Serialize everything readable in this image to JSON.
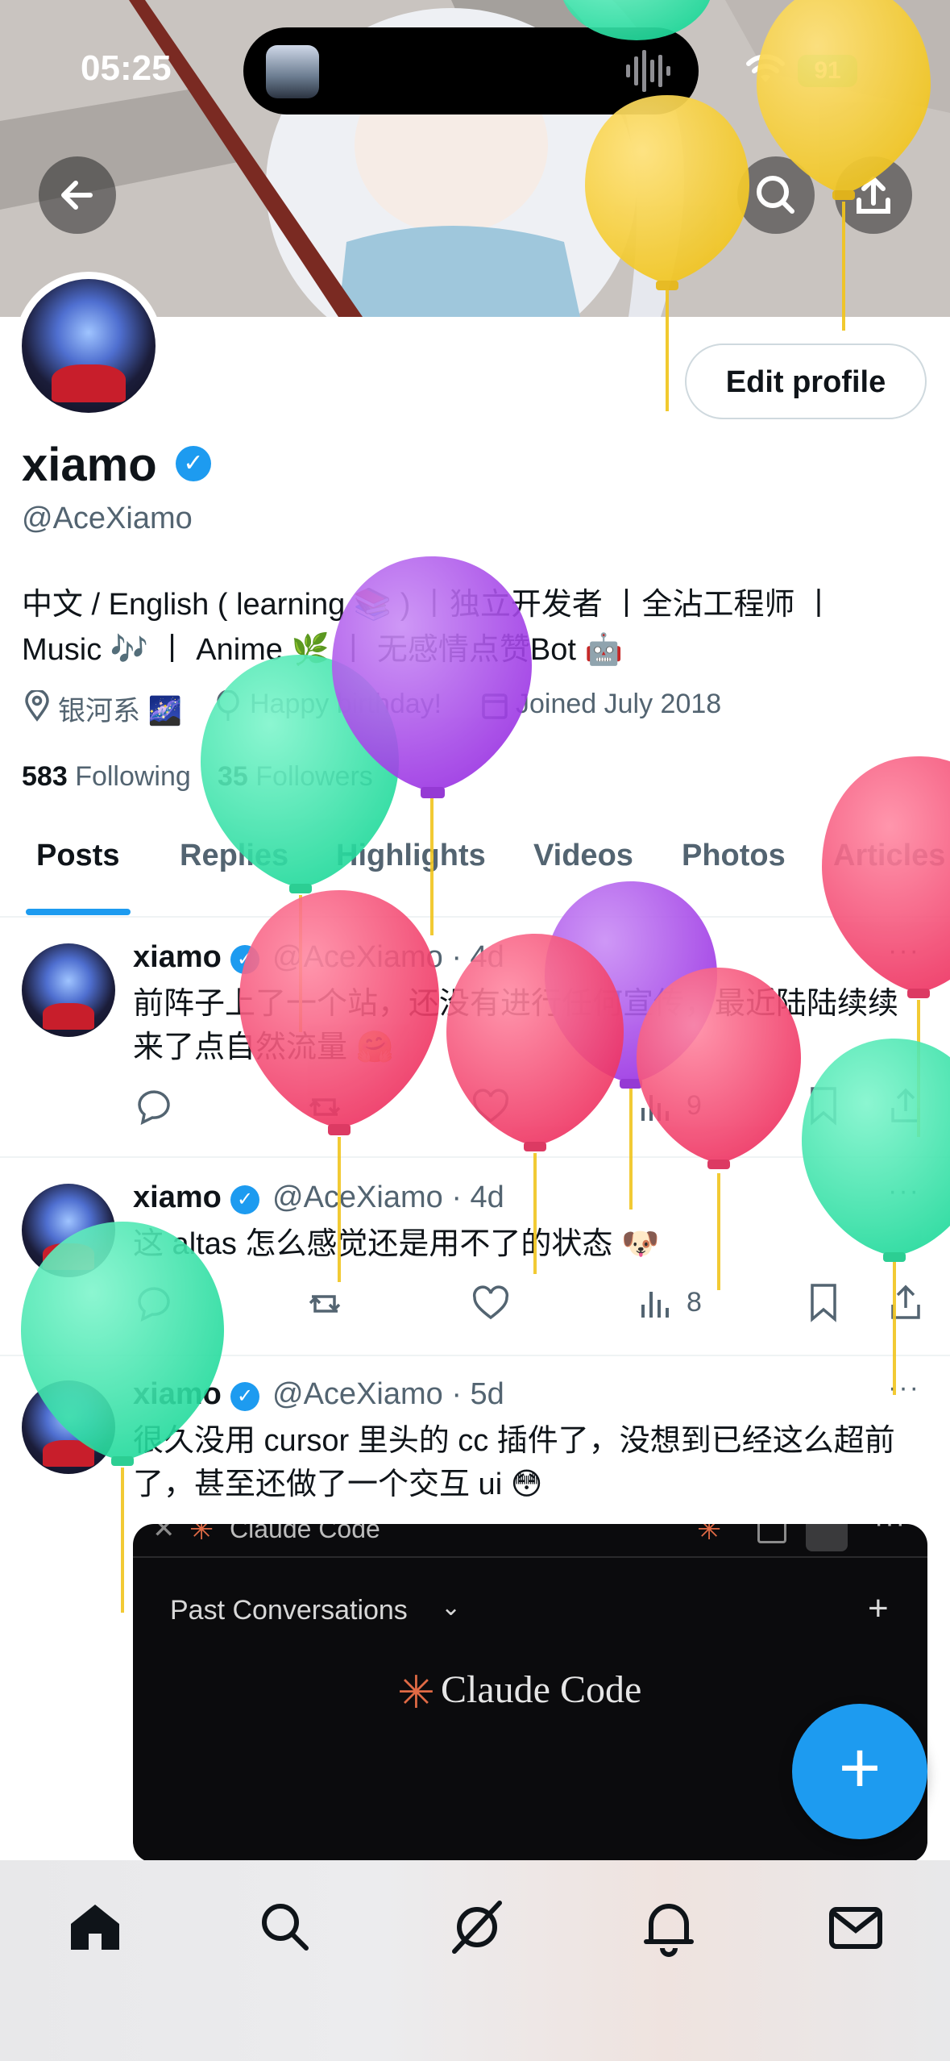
{
  "status_bar": {
    "time": "05:25",
    "battery": "91"
  },
  "profile": {
    "name": "xiamo",
    "handle": "@AceXiamo",
    "bio_line1": "中文 / English ( learning 📚 ) 丨独立开发者 丨全沾工程师 丨",
    "bio_line2": "Music 🎶 丨 Anime 🌿 丨 无感情点赞Bot 🤖",
    "location": "银河系 🌌",
    "birthday": "Happy birthday!",
    "joined": "Joined July 2018",
    "following_count": "583",
    "following_label": "Following",
    "followers_count": "35",
    "followers_label": "Followers",
    "edit_profile_label": "Edit profile"
  },
  "tabs": [
    "Posts",
    "Replies",
    "Highlights",
    "Videos",
    "Photos",
    "Articles"
  ],
  "posts": [
    {
      "name": "xiamo",
      "handle": "@AceXiamo · 4d",
      "text_line1": "前阵子上了一个站，还没有进行任何宣传，最近陆陆续续",
      "text_line2": "来了点自然流量 🤗",
      "views": "9"
    },
    {
      "name": "xiamo",
      "handle": "@AceXiamo · 4d",
      "text_line1": "这 altas 怎么感觉还是用不了的状态 🐶",
      "views": "8"
    },
    {
      "name": "xiamo",
      "handle": "@AceXiamo · 5d",
      "text_line1": "很久没用 cursor 里头的 cc 插件了，没想到已经这么超前",
      "text_line2": "了，甚至还做了一个交互 ui 😳"
    }
  ],
  "media_preview": {
    "tab_label": "Claude Code",
    "past_conversations": "Past Conversations",
    "logo_text": "Claude Code"
  },
  "icons": {
    "back": "back-arrow-icon",
    "search": "search-icon",
    "share": "share-icon",
    "reply": "reply-icon",
    "repost": "repost-icon",
    "like": "like-icon",
    "views": "views-icon",
    "bookmark": "bookmark-icon",
    "more": "more-icon",
    "compose": "plus-icon"
  },
  "colors": {
    "accent": "#1d9bf0",
    "text": "#0f1419",
    "muted": "#536471",
    "balloon_green": "#2ee8a8",
    "balloon_purple": "#a040e8",
    "balloon_pink": "#f23c64",
    "balloon_yellow": "#f4cf2e"
  }
}
